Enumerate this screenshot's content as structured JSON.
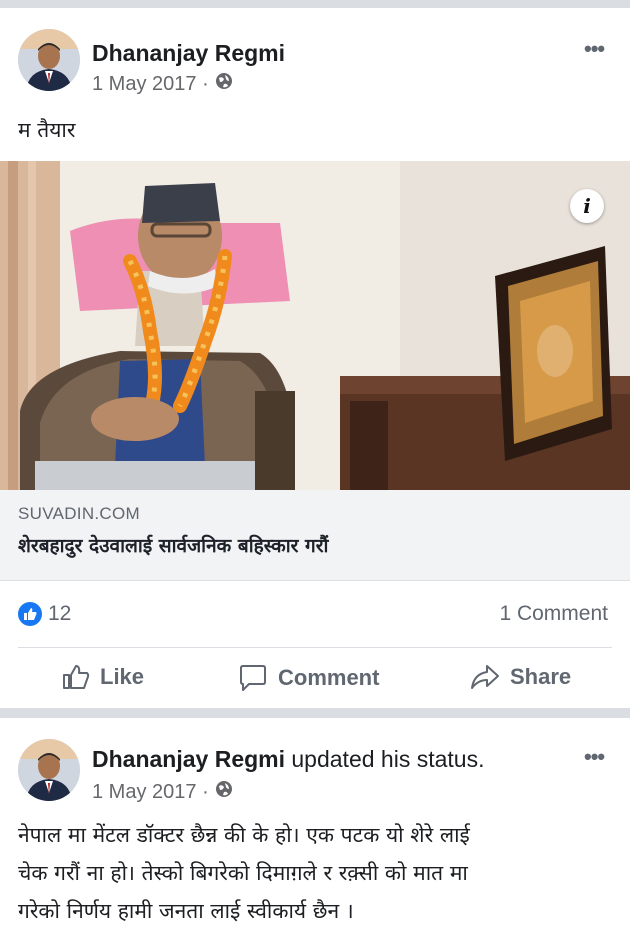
{
  "post1": {
    "author": "Dhananjay Regmi",
    "date": "1 May 2017 ·",
    "text": "म तैयार",
    "link": {
      "domain": "SUVADIN.COM",
      "title": "शेरबहादुर देउवालाई सार्वजनिक बहिस्कार गरौं"
    },
    "info_icon": "i",
    "like_count": "12",
    "comment_count": "1 Comment",
    "actions": {
      "like": "Like",
      "comment": "Comment",
      "share": "Share"
    }
  },
  "post2": {
    "author": "Dhananjay Regmi",
    "author_suffix": " updated his status.",
    "date": "1 May 2017 ·",
    "text_lines": [
      "नेपाल मा मेंटल डॉक्टर छैन्न की के हो। एक पटक यो शेरे लाई",
      "चेक गरौं ना हो। तेस्को बिगरेको दिमाग़ले र रक़्सी को मात मा",
      "गरेको निर्णय हामी जनता लाई स्वीकार्य छैन ।"
    ]
  },
  "more_label": "•••",
  "colors": {
    "accent": "#1877f2",
    "muted": "#65676b"
  }
}
